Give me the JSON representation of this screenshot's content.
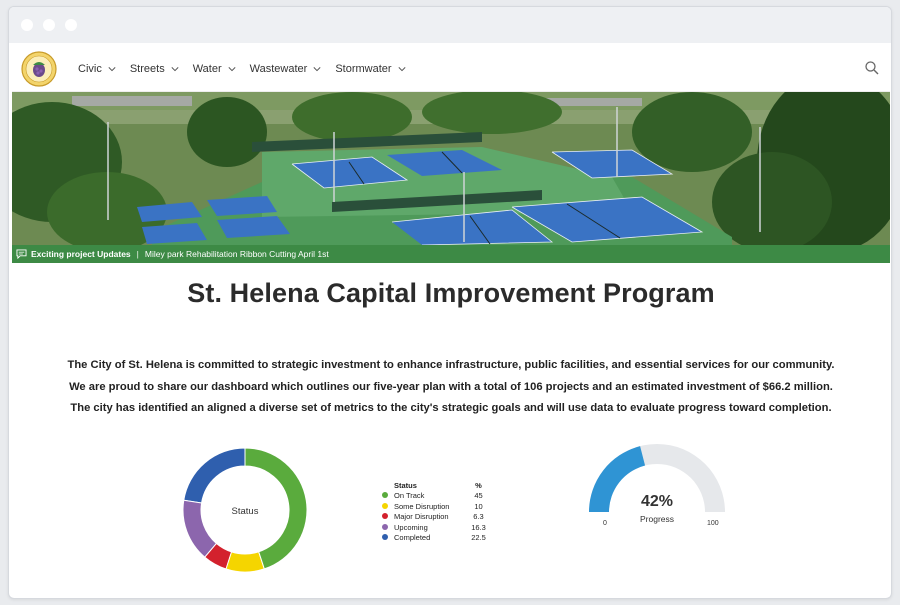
{
  "nav": {
    "items": [
      {
        "label": "Civic"
      },
      {
        "label": "Streets"
      },
      {
        "label": "Water"
      },
      {
        "label": "Wastewater"
      },
      {
        "label": "Stormwater"
      }
    ]
  },
  "ticker": {
    "tag": "Exciting project Updates",
    "separator": "|",
    "message": "Miley park Rehabilitation Ribbon Cutting April 1st"
  },
  "page": {
    "title": "St. Helena Capital Improvement Program",
    "intro": [
      "The City of St. Helena is committed to strategic investment to enhance infrastructure, public facilities, and essential services for our community.",
      "We are proud to share our dashboard which outlines our five-year plan with a total of 106 projects and an estimated investment of $66.2 million.",
      "The city has identified an aligned a diverse set of metrics to the city's strategic goals and will use data to evaluate progress toward completion."
    ]
  },
  "chart_data": [
    {
      "type": "pie",
      "title": "Status",
      "legend_header": {
        "label": "Status",
        "value": "%"
      },
      "categories": [
        "On Track",
        "Some Disruption",
        "Major Disruption",
        "Upcoming",
        "Completed"
      ],
      "values": [
        45,
        10,
        6.3,
        16.3,
        22.5
      ],
      "value_labels": [
        "45",
        "10",
        "6.3",
        "16.3",
        "22.5"
      ],
      "colors": [
        "#5aab3d",
        "#f5d500",
        "#d3212d",
        "#8c66ad",
        "#2f5fae"
      ]
    },
    {
      "type": "gauge",
      "value": 42,
      "value_label": "42%",
      "label": "Progress",
      "min": 0,
      "max": 100,
      "min_label": "0",
      "max_label": "100",
      "colors": {
        "fill": "#2f94d4",
        "track": "#e6e8eb"
      }
    }
  ]
}
